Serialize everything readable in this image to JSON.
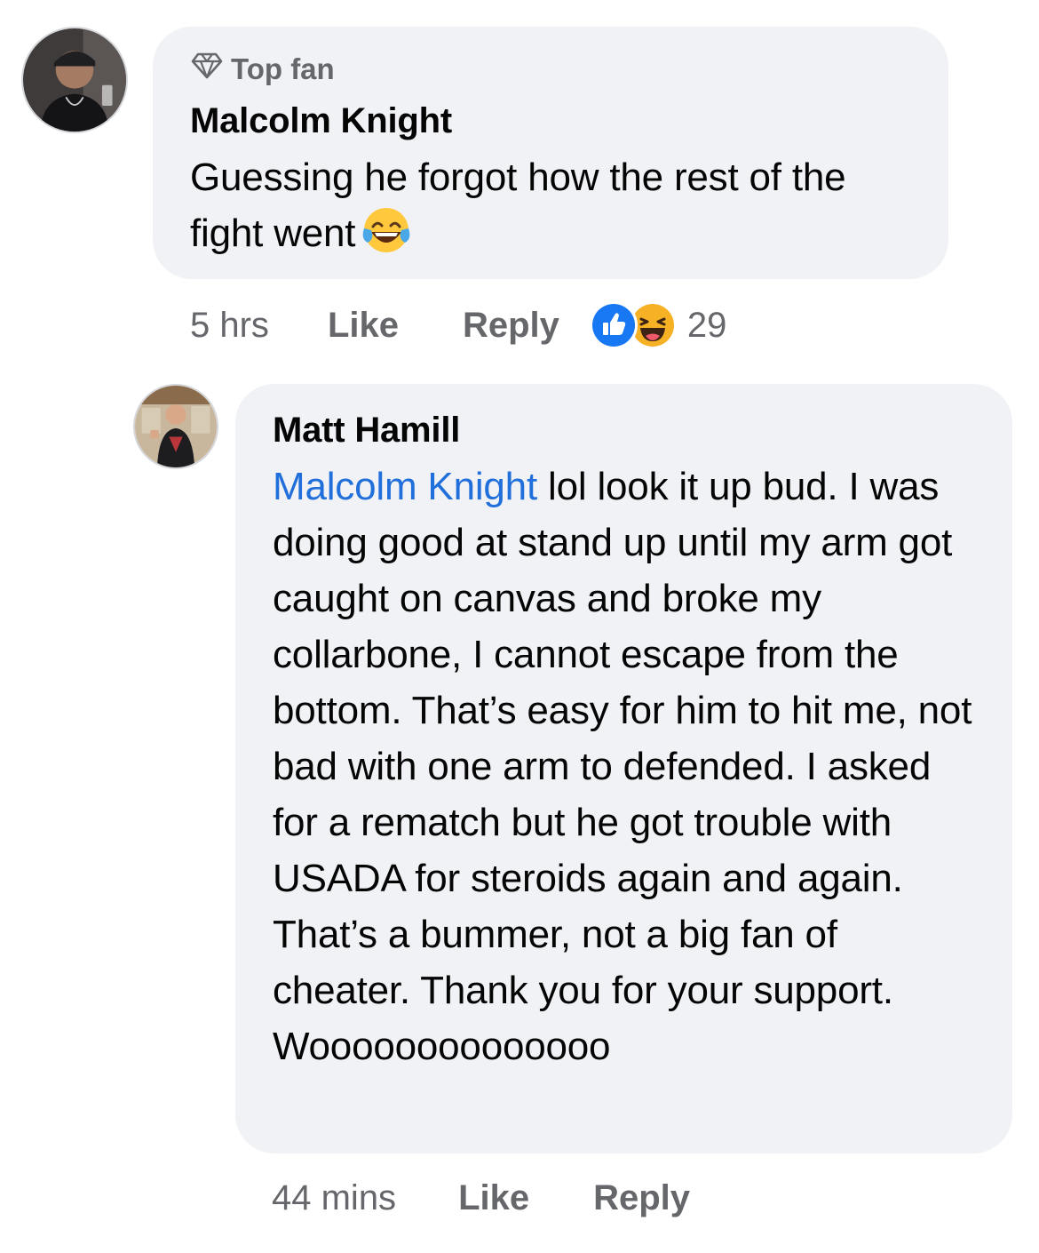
{
  "comments": [
    {
      "badge": "Top fan",
      "author": "Malcolm Knight",
      "text": "Guessing he forgot how the rest of the fight went",
      "emoji": "laughing-tears-emoji",
      "time": "5 hrs",
      "like_label": "Like",
      "reply_label": "Reply",
      "reactions": [
        "like-reaction-icon",
        "haha-reaction-icon"
      ],
      "reaction_count": "29"
    },
    {
      "author": "Matt Hamill",
      "mention": "Malcolm Knight",
      "text": "lol look it up bud. I was doing good at stand up until my arm got caught on canvas and broke my collarbone, I cannot escape from the bottom. That’s easy for him to hit me, not bad with one arm to defended. I asked for a rematch but he got trouble with USADA for steroids again and again. That’s a bummer, not a big fan of cheater. Thank you for your support. Woooooooooooooo",
      "time": "44 mins",
      "like_label": "Like",
      "reply_label": "Reply"
    }
  ],
  "colors": {
    "bubble": "#f0f2f5",
    "meta_text": "#65676b",
    "mention": "#216fdb",
    "like_blue": "#1877f2",
    "haha_yellow": "#f7b125"
  }
}
